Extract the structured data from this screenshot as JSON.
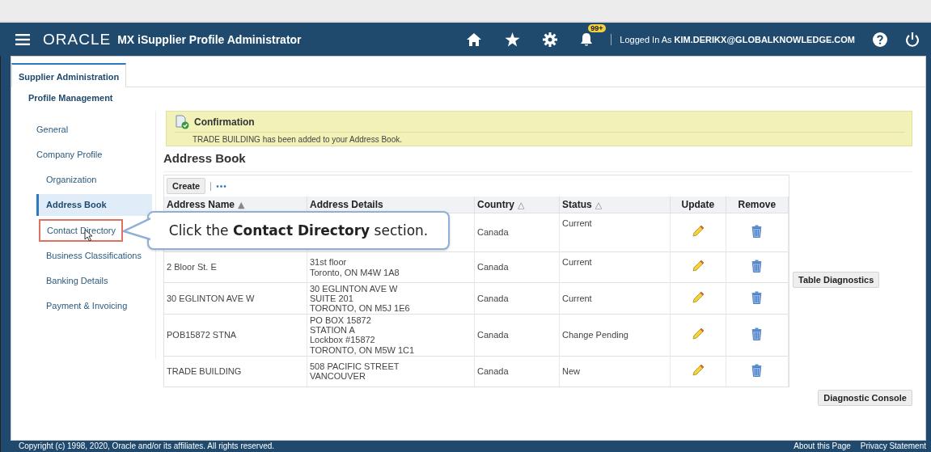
{
  "header": {
    "logo": "ORACLE",
    "title": "MX iSupplier Profile Administrator",
    "notification_count": "99+",
    "user_label": "Logged In As",
    "user": "KIM.DERIKX@GLOBALKNOWLEDGE.COM"
  },
  "tabs": [
    {
      "label": "Supplier Administration",
      "selected": true
    }
  ],
  "subtab": "Profile Management",
  "nav": [
    {
      "label": "General",
      "selected": false,
      "highlighted": false
    },
    {
      "label": "Company Profile",
      "selected": false,
      "highlighted": false,
      "children": [
        {
          "label": "Organization",
          "selected": false,
          "highlighted": false
        },
        {
          "label": "Address Book",
          "selected": true,
          "highlighted": false
        },
        {
          "label": "Contact Directory",
          "selected": false,
          "highlighted": true
        },
        {
          "label": "Business Classifications",
          "selected": false,
          "highlighted": false
        },
        {
          "label": "Banking Details",
          "selected": false,
          "highlighted": false
        },
        {
          "label": "Payment & Invoicing",
          "selected": false,
          "highlighted": false
        }
      ]
    }
  ],
  "confirmation": {
    "title": "Confirmation",
    "message": "TRADE BUILDING has been added to your Address Book."
  },
  "heading": "Address Book",
  "toolbar": {
    "button": "Create",
    "more": "•••"
  },
  "table": {
    "columns": [
      {
        "label": "Address Name",
        "sort_icon": "▲",
        "kind": "text"
      },
      {
        "label": "Address Details",
        "kind": "text"
      },
      {
        "label": "Country",
        "sort_icon": "△",
        "kind": "text"
      },
      {
        "label": "Status",
        "sort_icon": "△",
        "kind": "text"
      },
      {
        "label": "Update",
        "kind": "action"
      },
      {
        "label": "Remove",
        "kind": "action"
      }
    ],
    "rows": [
      {
        "country": "Canada",
        "status": "Current"
      },
      {
        "name": "2 Bloor St. E",
        "details": [
          "31st floor",
          "Toronto, ON M4W 1A8"
        ],
        "country": "Canada",
        "status": "Current"
      },
      {
        "name": "30 EGLINTON AVE W",
        "details": [
          "30 EGLINTON AVE W",
          "SUITE 201",
          "TORONTO, ON M5J 1E6"
        ],
        "country": "Canada",
        "status": "Current"
      },
      {
        "name": "POB15872 STNA",
        "details": [
          "PO BOX 15872",
          "STATION A",
          "Lockbox #15872",
          "TORONTO, ON M5W 1C1"
        ],
        "country": "Canada",
        "status": "Change Pending"
      },
      {
        "name": "TRADE BUILDING",
        "details": [
          "508 PACIFIC STREET",
          "VANCOUVER"
        ],
        "country": "Canada",
        "status": "New"
      }
    ]
  },
  "buttons": {
    "table_diagnostics": "Table Diagnostics",
    "diagnostic_console": "Diagnostic Console"
  },
  "callout": "Click the **Contact Directory** section.",
  "footer": {
    "copyright": "Copyright (c) 1998, 2020, Oracle and/or its affiliates. All rights reserved.",
    "links": [
      "About this Page",
      "Privacy Statement"
    ]
  }
}
